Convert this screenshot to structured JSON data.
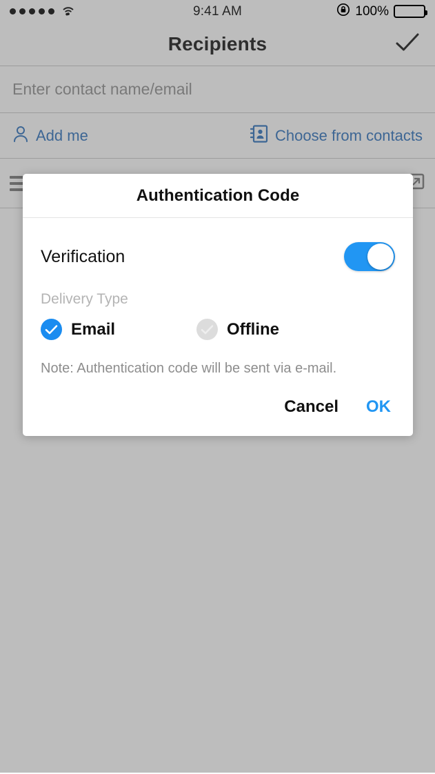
{
  "status_bar": {
    "signal_dots": 5,
    "wifi_icon": "wifi-icon",
    "time": "9:41 AM",
    "rotation_lock_icon": "rotation-lock-icon",
    "battery_percent": "100%",
    "battery_icon": "battery-full-icon"
  },
  "nav_bar": {
    "title": "Recipients",
    "confirm_icon": "checkmark-icon"
  },
  "search": {
    "value": "",
    "placeholder": "Enter contact name/email"
  },
  "actions": {
    "add_me": {
      "label": "Add me",
      "icon": "person-icon"
    },
    "choose_contacts": {
      "label": "Choose from contacts",
      "icon": "address-book-icon"
    }
  },
  "recipient_row": {
    "drag_handle_icon": "drag-handle-icon",
    "open_icon": "external-link-icon"
  },
  "dialog": {
    "title": "Authentication Code",
    "verification": {
      "label": "Verification",
      "enabled": true
    },
    "delivery_type": {
      "label": "Delivery Type",
      "options": [
        {
          "label": "Email",
          "selected": true
        },
        {
          "label": "Offline",
          "selected": false
        }
      ]
    },
    "note": "Note: Authentication code will be sent via e-mail.",
    "buttons": {
      "cancel": "Cancel",
      "ok": "OK"
    }
  },
  "colors": {
    "accent_blue": "#2196f3",
    "link_blue": "#2a6ebb",
    "overlay_gray": "#999999",
    "muted_text": "#8d8d8d"
  }
}
